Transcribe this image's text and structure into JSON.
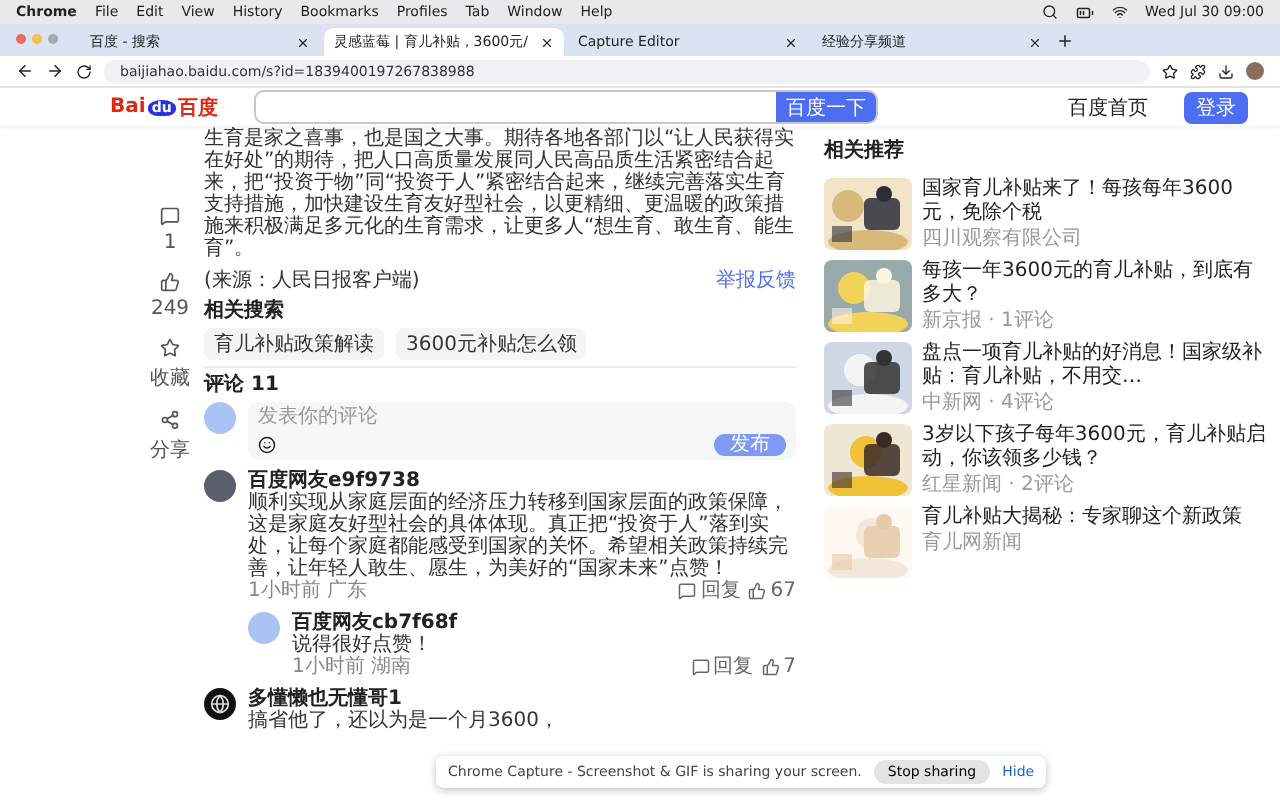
{
  "menubar": {
    "app": "Chrome",
    "items": [
      "File",
      "Edit",
      "View",
      "History",
      "Bookmarks",
      "Profiles",
      "Tab",
      "Window",
      "Help"
    ],
    "clock": "Wed Jul 30 09:00"
  },
  "tabs": [
    {
      "title": "百度 - 搜索",
      "selected": false
    },
    {
      "title": "灵感蓝莓 | 育儿补贴，3600元/",
      "selected": true
    },
    {
      "title": "Capture Editor",
      "selected": false
    },
    {
      "title": "经验分享频道",
      "selected": false
    }
  ],
  "address": "baijiahao.baidu.com/s?id=1839400197267838988",
  "header": {
    "logo": [
      "Bai",
      "du",
      "百度"
    ],
    "search_button": "百度一下",
    "links": [
      {
        "label": "百度首页",
        "kind": "link"
      },
      {
        "label": "登录",
        "kind": "button"
      }
    ]
  },
  "rail": [
    {
      "kind": "comment",
      "label": "1"
    },
    {
      "kind": "like",
      "label": "249"
    },
    {
      "kind": "star",
      "label": "收藏"
    },
    {
      "kind": "share",
      "label": "分享"
    }
  ],
  "article": {
    "paragraph": "生育是家之喜事，也是国之大事。期待各地各部门以“让人民获得实在好处”的期待，把人口高质量发展同人民高品质生活紧密结合起来，把“投资于物”同“投资于人”紧密结合起来，继续完善落实生育支持措施，加快建设生育友好型社会，以更精细、更温暖的政策措施来积极满足多元化的生育需求，让更多人“想生育、敢生育、能生育”。",
    "source": "(来源：人民日报客户端)",
    "report": "举报反馈"
  },
  "related": {
    "title": "相关搜索",
    "chips": [
      "育儿补贴政策解读",
      "3600元补贴怎么领"
    ]
  },
  "comments": {
    "title": "评论 11",
    "placeholder": "发表你的评论",
    "submit": "发布",
    "items": [
      {
        "name": "百度网友e9f9738",
        "kind": "figure",
        "text": "顺利实现从家庭层面的经济压力转移到国家层面的政策保障，这是家庭友好型社会的具体体现。真正把“投资于人”落到实处，让每个家庭都能感受到国家的关怀。希望相关政策持续完善，让年轻人敢生、愿生，为美好的“国家未来”点赞！",
        "time": "1小时前 广东",
        "reply": "回复",
        "likes": "67",
        "replies": [
          {
            "name": "百度网友cb7f68f",
            "kind": "plain",
            "text": "说得很好点赞！",
            "time": "1小时前 湖南",
            "reply": "回复",
            "likes": "7"
          }
        ]
      },
      {
        "name": "多懂懒也无懂哥1",
        "kind": "dark",
        "text": "搞省他了，还以为是一个月3600，"
      }
    ]
  },
  "sidebar": {
    "title": "相关推荐",
    "items": [
      {
        "title": "国家育儿补贴来了！每孩每年3600元，免除个税",
        "meta": "四川观察有限公司"
      },
      {
        "title": "每孩一年3600元的育儿补贴，到底有多大？",
        "meta": "新京报 · 1评论"
      },
      {
        "title": "盘点一项育儿补贴的好消息！国家级补贴：育儿补贴，不用交…",
        "meta": "中新网 · 4评论"
      },
      {
        "title": "3岁以下孩子每年3600元，育儿补贴启动，你该领多少钱？",
        "meta": "红星新闻 · 2评论"
      },
      {
        "title": "育儿补贴大揭秘：专家聊这个新政策",
        "meta": "育儿网新闻"
      }
    ]
  },
  "share_bar": {
    "message": "Chrome Capture - Screenshot & GIF is sharing your screen.",
    "stop": "Stop sharing",
    "hide": "Hide"
  }
}
